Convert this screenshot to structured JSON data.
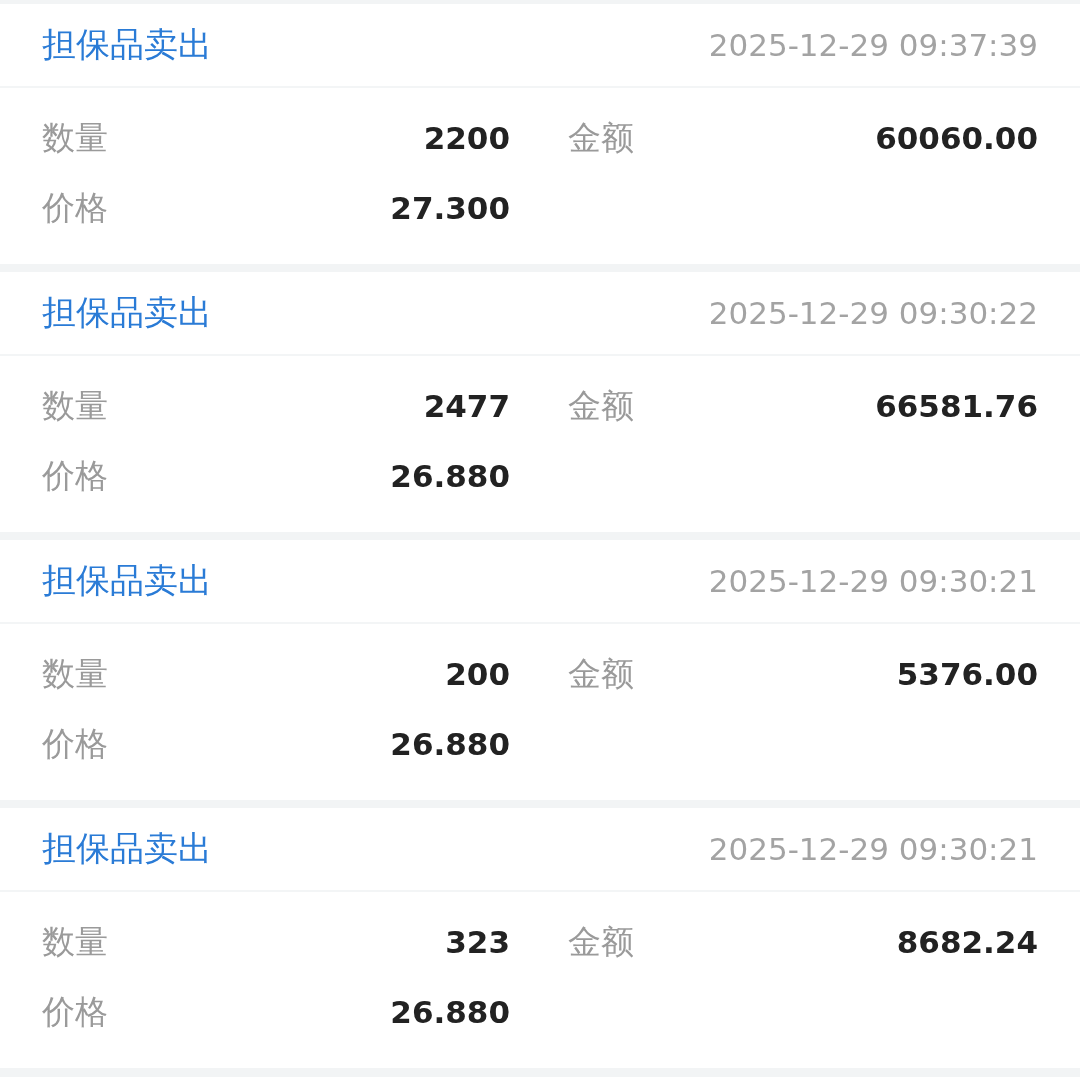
{
  "records": [
    {
      "type": "担保品卖出",
      "time": "2025-12-29 09:37:39",
      "fields": [
        {
          "label": "数量",
          "value": "2200"
        },
        {
          "label": "金额",
          "value": "60060.00"
        },
        {
          "label": "价格",
          "value": "27.300"
        }
      ]
    },
    {
      "type": "担保品卖出",
      "time": "2025-12-29 09:30:22",
      "fields": [
        {
          "label": "数量",
          "value": "2477"
        },
        {
          "label": "金额",
          "value": "66581.76"
        },
        {
          "label": "价格",
          "value": "26.880"
        }
      ]
    },
    {
      "type": "担保品卖出",
      "time": "2025-12-29 09:30:21",
      "fields": [
        {
          "label": "数量",
          "value": "200"
        },
        {
          "label": "金额",
          "value": "5376.00"
        },
        {
          "label": "价格",
          "value": "26.880"
        }
      ]
    },
    {
      "type": "担保品卖出",
      "time": "2025-12-29 09:30:21",
      "fields": [
        {
          "label": "数量",
          "value": "323"
        },
        {
          "label": "金额",
          "value": "8682.24"
        },
        {
          "label": "价格",
          "value": "26.880"
        }
      ]
    }
  ]
}
